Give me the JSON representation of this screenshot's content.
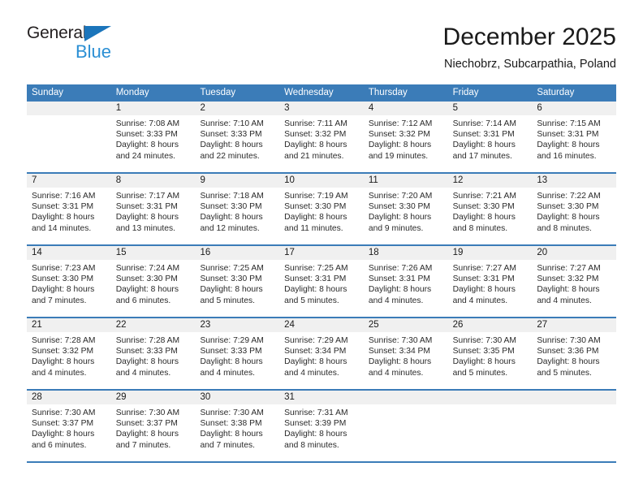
{
  "brand": {
    "name_part1": "General",
    "name_part2": "Blue",
    "logo_icon": "triangle-icon",
    "accent_color": "#1b75bb",
    "secondary_color": "#2b8fd4"
  },
  "header": {
    "title": "December 2025",
    "subtitle": "Niechobrz, Subcarpathia, Poland"
  },
  "calendar": {
    "header_bg_color": "#3b7cb8",
    "daynum_bg_color": "#f0f0f0",
    "weekday_headers": [
      "Sunday",
      "Monday",
      "Tuesday",
      "Wednesday",
      "Thursday",
      "Friday",
      "Saturday"
    ],
    "weeks": [
      [
        {
          "day": "",
          "sunrise": "",
          "sunset": "",
          "daylight_line1": "",
          "daylight_line2": ""
        },
        {
          "day": "1",
          "sunrise": "Sunrise: 7:08 AM",
          "sunset": "Sunset: 3:33 PM",
          "daylight_line1": "Daylight: 8 hours",
          "daylight_line2": "and 24 minutes."
        },
        {
          "day": "2",
          "sunrise": "Sunrise: 7:10 AM",
          "sunset": "Sunset: 3:33 PM",
          "daylight_line1": "Daylight: 8 hours",
          "daylight_line2": "and 22 minutes."
        },
        {
          "day": "3",
          "sunrise": "Sunrise: 7:11 AM",
          "sunset": "Sunset: 3:32 PM",
          "daylight_line1": "Daylight: 8 hours",
          "daylight_line2": "and 21 minutes."
        },
        {
          "day": "4",
          "sunrise": "Sunrise: 7:12 AM",
          "sunset": "Sunset: 3:32 PM",
          "daylight_line1": "Daylight: 8 hours",
          "daylight_line2": "and 19 minutes."
        },
        {
          "day": "5",
          "sunrise": "Sunrise: 7:14 AM",
          "sunset": "Sunset: 3:31 PM",
          "daylight_line1": "Daylight: 8 hours",
          "daylight_line2": "and 17 minutes."
        },
        {
          "day": "6",
          "sunrise": "Sunrise: 7:15 AM",
          "sunset": "Sunset: 3:31 PM",
          "daylight_line1": "Daylight: 8 hours",
          "daylight_line2": "and 16 minutes."
        }
      ],
      [
        {
          "day": "7",
          "sunrise": "Sunrise: 7:16 AM",
          "sunset": "Sunset: 3:31 PM",
          "daylight_line1": "Daylight: 8 hours",
          "daylight_line2": "and 14 minutes."
        },
        {
          "day": "8",
          "sunrise": "Sunrise: 7:17 AM",
          "sunset": "Sunset: 3:31 PM",
          "daylight_line1": "Daylight: 8 hours",
          "daylight_line2": "and 13 minutes."
        },
        {
          "day": "9",
          "sunrise": "Sunrise: 7:18 AM",
          "sunset": "Sunset: 3:30 PM",
          "daylight_line1": "Daylight: 8 hours",
          "daylight_line2": "and 12 minutes."
        },
        {
          "day": "10",
          "sunrise": "Sunrise: 7:19 AM",
          "sunset": "Sunset: 3:30 PM",
          "daylight_line1": "Daylight: 8 hours",
          "daylight_line2": "and 11 minutes."
        },
        {
          "day": "11",
          "sunrise": "Sunrise: 7:20 AM",
          "sunset": "Sunset: 3:30 PM",
          "daylight_line1": "Daylight: 8 hours",
          "daylight_line2": "and 9 minutes."
        },
        {
          "day": "12",
          "sunrise": "Sunrise: 7:21 AM",
          "sunset": "Sunset: 3:30 PM",
          "daylight_line1": "Daylight: 8 hours",
          "daylight_line2": "and 8 minutes."
        },
        {
          "day": "13",
          "sunrise": "Sunrise: 7:22 AM",
          "sunset": "Sunset: 3:30 PM",
          "daylight_line1": "Daylight: 8 hours",
          "daylight_line2": "and 8 minutes."
        }
      ],
      [
        {
          "day": "14",
          "sunrise": "Sunrise: 7:23 AM",
          "sunset": "Sunset: 3:30 PM",
          "daylight_line1": "Daylight: 8 hours",
          "daylight_line2": "and 7 minutes."
        },
        {
          "day": "15",
          "sunrise": "Sunrise: 7:24 AM",
          "sunset": "Sunset: 3:30 PM",
          "daylight_line1": "Daylight: 8 hours",
          "daylight_line2": "and 6 minutes."
        },
        {
          "day": "16",
          "sunrise": "Sunrise: 7:25 AM",
          "sunset": "Sunset: 3:30 PM",
          "daylight_line1": "Daylight: 8 hours",
          "daylight_line2": "and 5 minutes."
        },
        {
          "day": "17",
          "sunrise": "Sunrise: 7:25 AM",
          "sunset": "Sunset: 3:31 PM",
          "daylight_line1": "Daylight: 8 hours",
          "daylight_line2": "and 5 minutes."
        },
        {
          "day": "18",
          "sunrise": "Sunrise: 7:26 AM",
          "sunset": "Sunset: 3:31 PM",
          "daylight_line1": "Daylight: 8 hours",
          "daylight_line2": "and 4 minutes."
        },
        {
          "day": "19",
          "sunrise": "Sunrise: 7:27 AM",
          "sunset": "Sunset: 3:31 PM",
          "daylight_line1": "Daylight: 8 hours",
          "daylight_line2": "and 4 minutes."
        },
        {
          "day": "20",
          "sunrise": "Sunrise: 7:27 AM",
          "sunset": "Sunset: 3:32 PM",
          "daylight_line1": "Daylight: 8 hours",
          "daylight_line2": "and 4 minutes."
        }
      ],
      [
        {
          "day": "21",
          "sunrise": "Sunrise: 7:28 AM",
          "sunset": "Sunset: 3:32 PM",
          "daylight_line1": "Daylight: 8 hours",
          "daylight_line2": "and 4 minutes."
        },
        {
          "day": "22",
          "sunrise": "Sunrise: 7:28 AM",
          "sunset": "Sunset: 3:33 PM",
          "daylight_line1": "Daylight: 8 hours",
          "daylight_line2": "and 4 minutes."
        },
        {
          "day": "23",
          "sunrise": "Sunrise: 7:29 AM",
          "sunset": "Sunset: 3:33 PM",
          "daylight_line1": "Daylight: 8 hours",
          "daylight_line2": "and 4 minutes."
        },
        {
          "day": "24",
          "sunrise": "Sunrise: 7:29 AM",
          "sunset": "Sunset: 3:34 PM",
          "daylight_line1": "Daylight: 8 hours",
          "daylight_line2": "and 4 minutes."
        },
        {
          "day": "25",
          "sunrise": "Sunrise: 7:30 AM",
          "sunset": "Sunset: 3:34 PM",
          "daylight_line1": "Daylight: 8 hours",
          "daylight_line2": "and 4 minutes."
        },
        {
          "day": "26",
          "sunrise": "Sunrise: 7:30 AM",
          "sunset": "Sunset: 3:35 PM",
          "daylight_line1": "Daylight: 8 hours",
          "daylight_line2": "and 5 minutes."
        },
        {
          "day": "27",
          "sunrise": "Sunrise: 7:30 AM",
          "sunset": "Sunset: 3:36 PM",
          "daylight_line1": "Daylight: 8 hours",
          "daylight_line2": "and 5 minutes."
        }
      ],
      [
        {
          "day": "28",
          "sunrise": "Sunrise: 7:30 AM",
          "sunset": "Sunset: 3:37 PM",
          "daylight_line1": "Daylight: 8 hours",
          "daylight_line2": "and 6 minutes."
        },
        {
          "day": "29",
          "sunrise": "Sunrise: 7:30 AM",
          "sunset": "Sunset: 3:37 PM",
          "daylight_line1": "Daylight: 8 hours",
          "daylight_line2": "and 7 minutes."
        },
        {
          "day": "30",
          "sunrise": "Sunrise: 7:30 AM",
          "sunset": "Sunset: 3:38 PM",
          "daylight_line1": "Daylight: 8 hours",
          "daylight_line2": "and 7 minutes."
        },
        {
          "day": "31",
          "sunrise": "Sunrise: 7:31 AM",
          "sunset": "Sunset: 3:39 PM",
          "daylight_line1": "Daylight: 8 hours",
          "daylight_line2": "and 8 minutes."
        },
        {
          "day": "",
          "sunrise": "",
          "sunset": "",
          "daylight_line1": "",
          "daylight_line2": ""
        },
        {
          "day": "",
          "sunrise": "",
          "sunset": "",
          "daylight_line1": "",
          "daylight_line2": ""
        },
        {
          "day": "",
          "sunrise": "",
          "sunset": "",
          "daylight_line1": "",
          "daylight_line2": ""
        }
      ]
    ]
  }
}
